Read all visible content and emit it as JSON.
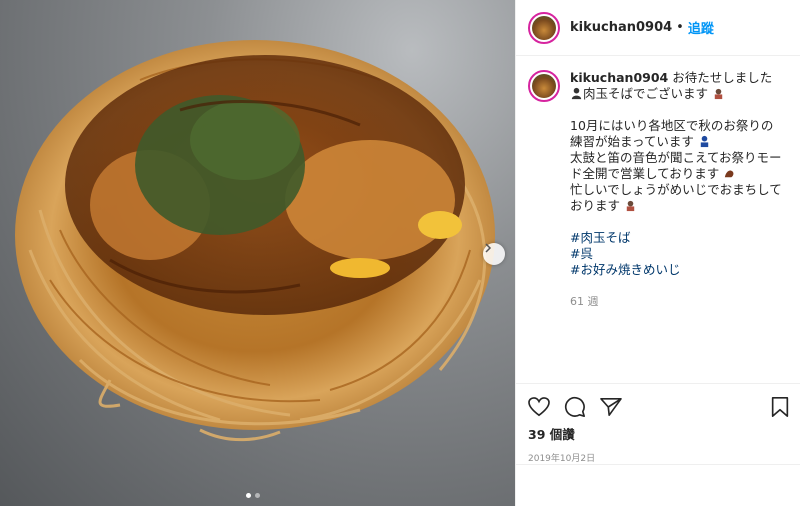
{
  "post": {
    "username": "kikuchan0904",
    "separator": "•",
    "follow_label": "追蹤"
  },
  "caption": {
    "username": "kikuchan0904",
    "line1_text": "お待たせしました",
    "line1_text2": "肉玉そばでございます",
    "para2_line1": "10月にはいり各地区で秋のお祭りの練習が始まっています",
    "para2_line2": "太鼓と笛の音色が聞こえてお祭りモード全開で営業しております",
    "para2_line3": "忙しいでしょうがめいじでおまちしております",
    "hashtags": [
      "#肉玉そば",
      "#呉",
      "#お好み焼きめいじ"
    ],
    "weeks": "61 週"
  },
  "actions": {
    "icons": [
      "heart-icon",
      "comment-icon",
      "share-icon",
      "bookmark-icon"
    ],
    "likes": "39 個讚",
    "date": "2019年10月2日"
  },
  "colors": {
    "accent": "#0095f6",
    "hashtag": "#00376b",
    "muted": "#8e8e8e"
  }
}
